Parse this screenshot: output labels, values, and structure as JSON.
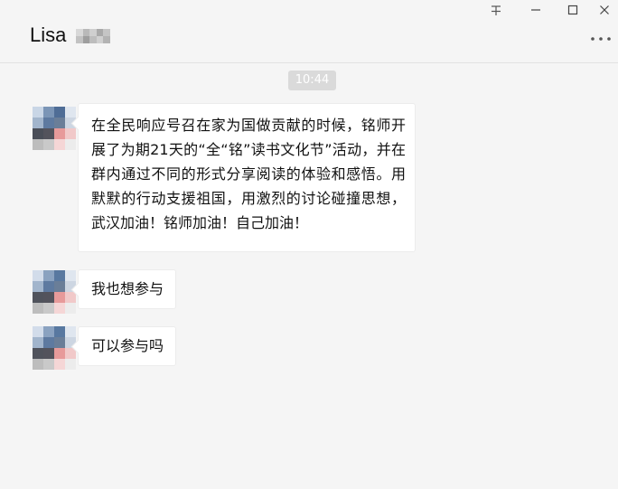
{
  "window": {
    "title": "Lisa",
    "controls": [
      "pin",
      "minimize",
      "maximize",
      "close"
    ]
  },
  "chat": {
    "timestamp": "10:44",
    "messages": [
      {
        "text": "在全民响应号召在家为国做贡献的时候，铭师开展了为期21天的“全“铭”读书文化节”活动，并在群内通过不同的形式分享阅读的体验和感悟。用默默的行动支援祖国，用激烈的讨论碰撞思想，武汉加油！铭师加油！自己加油！"
      },
      {
        "text": "我也想参与"
      },
      {
        "text": "可以参与吗"
      }
    ]
  },
  "icons": {
    "pin": "pin-icon",
    "minimize": "minimize-icon",
    "maximize": "maximize-icon",
    "close": "close-icon",
    "more": "more-icon"
  },
  "colors": {
    "background": "#f5f5f5",
    "bubble": "#ffffff",
    "timestamp_bg": "#dadada"
  }
}
